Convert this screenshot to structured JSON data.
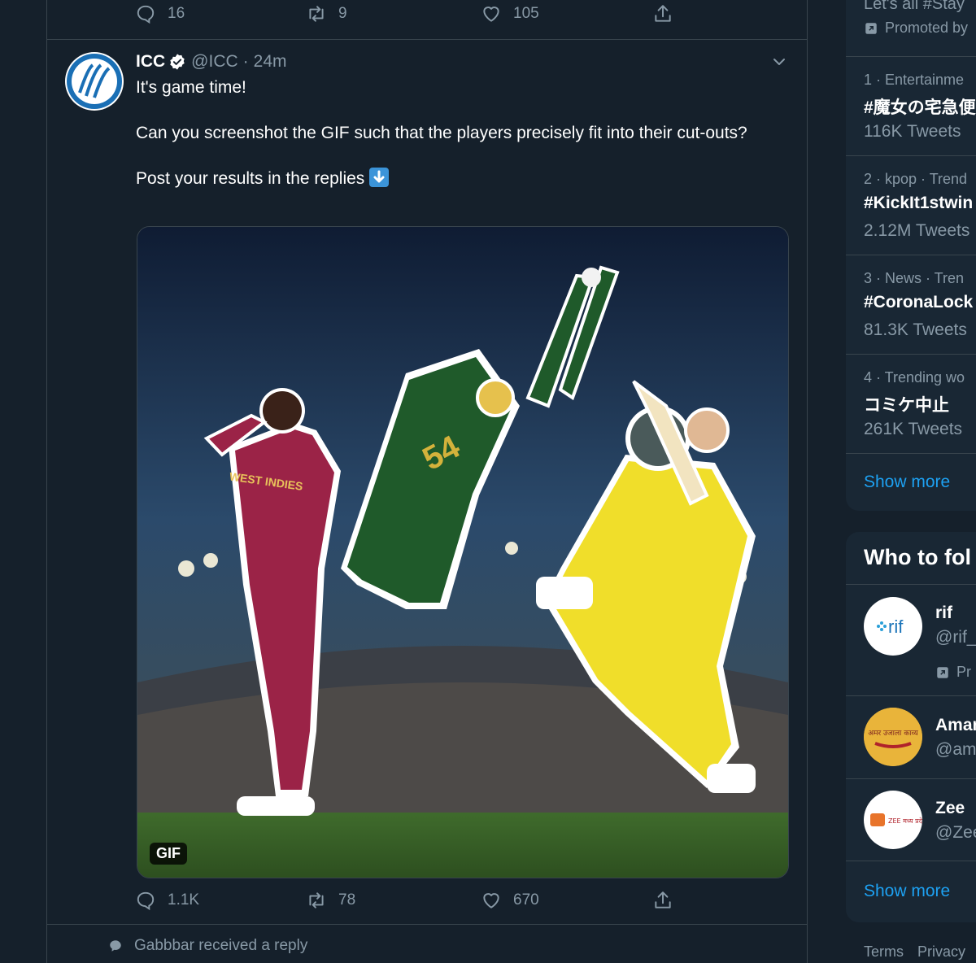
{
  "prev_tweet": {
    "replies": "16",
    "retweets": "9",
    "likes": "105"
  },
  "tweet": {
    "name": "ICC",
    "handle": "@ICC",
    "time": "24m",
    "line1": "It's game time!",
    "line2": "Can you screenshot the GIF such that the players precisely fit into their cut-outs?",
    "line3": "Post your results in the replies",
    "media_badge": "GIF",
    "jersey_text": "WEST INDIES",
    "replies": "1.1K",
    "retweets": "78",
    "likes": "670"
  },
  "notification": "Gabbbar received a reply",
  "trends": {
    "promo_top": "Let's all #Stay",
    "promo_label": "Promoted by",
    "items": [
      {
        "meta": "1 · Entertainme",
        "name": "#魔女の宅急便",
        "count": "116K Tweets"
      },
      {
        "meta": "2 · kpop · Trend",
        "name": "#KickIt1stwin",
        "count": "2.12M Tweets"
      },
      {
        "meta": "3 · News · Tren",
        "name": "#CoronaLock",
        "count": "81.3K Tweets"
      },
      {
        "meta": "4 · Trending wo",
        "name": "コミケ中止",
        "count": "261K Tweets"
      }
    ],
    "show_more": "Show more"
  },
  "who_to_follow": {
    "title": "Who to fol",
    "accounts": [
      {
        "name": "rif",
        "handle": "@rif_",
        "promo": "Pr",
        "avatar_text": "rif"
      },
      {
        "name": "Amar",
        "handle": "@am",
        "avatar_text": "अमर उजाला काव्य"
      },
      {
        "name": "Zee",
        "handle": "@Zee",
        "avatar_text": "ZEE मध्य प्रदेश छत्तीसगढ़"
      }
    ],
    "show_more": "Show more"
  },
  "footer": {
    "terms": "Terms",
    "privacy": "Privacy"
  },
  "colors": {
    "background": "#15202b",
    "panel": "#192734",
    "accent": "#1da1f2",
    "muted": "#8899a6"
  }
}
